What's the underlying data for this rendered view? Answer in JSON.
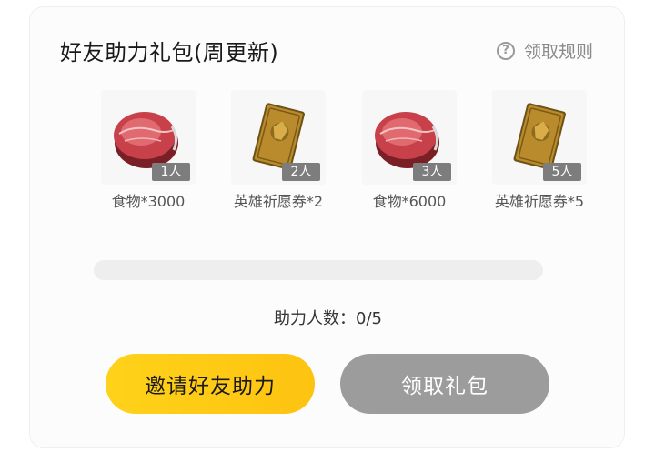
{
  "panel": {
    "title": "好友助力礼包(周更新)",
    "rules_label": "领取规则"
  },
  "rewards": [
    {
      "icon": "meat-icon",
      "badge": "1人",
      "name": "食物*3000"
    },
    {
      "icon": "hero-card-icon",
      "badge": "2人",
      "name": "英雄祈愿券*2"
    },
    {
      "icon": "meat-icon",
      "badge": "3人",
      "name": "食物*6000"
    },
    {
      "icon": "hero-card-icon",
      "badge": "5人",
      "name": "英雄祈愿券*5"
    }
  ],
  "progress": {
    "current": 0,
    "total": 5,
    "fraction": 0,
    "label": "助力人数：0/5"
  },
  "buttons": {
    "invite_label": "邀请好友助力",
    "claim_label": "领取礼包"
  },
  "colors": {
    "invite_button": "#ffcc1a",
    "claim_button_disabled": "#9c9c9c",
    "badge": "#7d7d7d"
  }
}
